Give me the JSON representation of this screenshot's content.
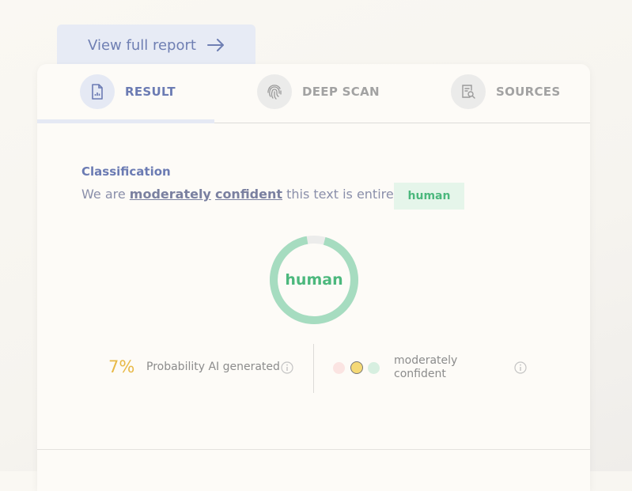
{
  "report_tab": {
    "label": "View full report"
  },
  "tabs": [
    {
      "label": "RESULT",
      "icon": "report-chart-icon",
      "active": true
    },
    {
      "label": "DEEP SCAN",
      "icon": "fingerprint-icon",
      "active": false
    },
    {
      "label": "SOURCES",
      "icon": "document-search-icon",
      "active": false
    }
  ],
  "classification": {
    "title": "Classification",
    "sentence_prefix": "We are",
    "confidence_word1": "moderately",
    "confidence_word2": "confident",
    "sentence_suffix": "this text is entirely",
    "badge": "human"
  },
  "donut": {
    "label": "human",
    "human_fraction": 0.93,
    "color": "#a6dcc0",
    "track_color": "#ececeb"
  },
  "stats": {
    "ai_probability": "7%",
    "ai_probability_label": "Probability AI generated",
    "confidence_label": "moderately confident",
    "confidence_dots": [
      "#fbe4e2",
      "#f5d976",
      "#d7efe0"
    ]
  },
  "colors": {
    "accent": "#6b7bb3",
    "human_green": "#4cb87d",
    "ai_yellow": "#e8b947"
  }
}
